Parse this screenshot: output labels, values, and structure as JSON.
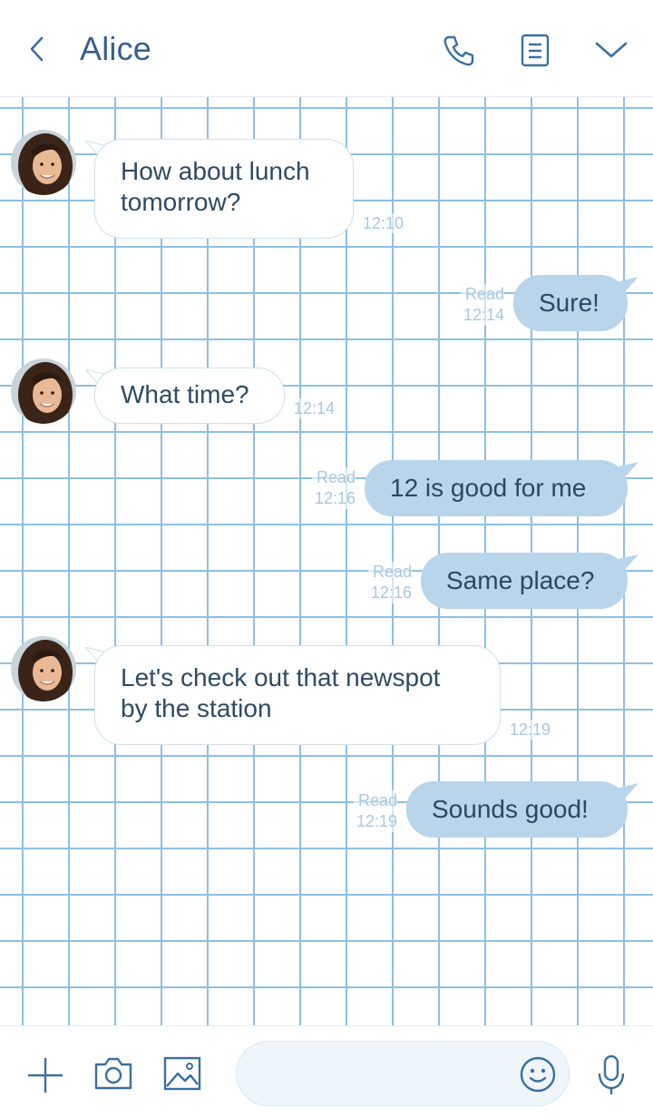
{
  "header": {
    "title": "Alice",
    "back_icon": "chevron-left-icon",
    "call_icon": "phone-icon",
    "notes_icon": "notes-icon",
    "menu_icon": "chevron-down-icon"
  },
  "messages": [
    {
      "direction": "in",
      "lines": [
        "How about lunch",
        "tomorrow?"
      ],
      "time": "12:10"
    },
    {
      "direction": "out",
      "text": "Sure!",
      "read": "Read",
      "time": "12:14"
    },
    {
      "direction": "in",
      "lines": [
        "What time?"
      ],
      "time": "12:14"
    },
    {
      "direction": "out",
      "text": "12 is good for me",
      "read": "Read",
      "time": "12:16"
    },
    {
      "direction": "out",
      "text": "Same place?",
      "read": "Read",
      "time": "12:16"
    },
    {
      "direction": "in",
      "lines": [
        "Let's check out that newspot",
        "by the station"
      ],
      "time": "12:19"
    },
    {
      "direction": "out",
      "text": "Sounds good!",
      "read": "Read",
      "time": "12:19"
    }
  ],
  "footer": {
    "add_icon": "plus-icon",
    "camera_icon": "camera-icon",
    "gallery_icon": "image-icon",
    "input_placeholder": "",
    "emoji_icon": "smiley-icon",
    "mic_icon": "microphone-icon"
  },
  "colors": {
    "accent": "#3a6f9f",
    "grid": "#8ec0e2",
    "outgoing_bubble": "#b8d5ec",
    "meta_text": "#a8c7e0"
  }
}
